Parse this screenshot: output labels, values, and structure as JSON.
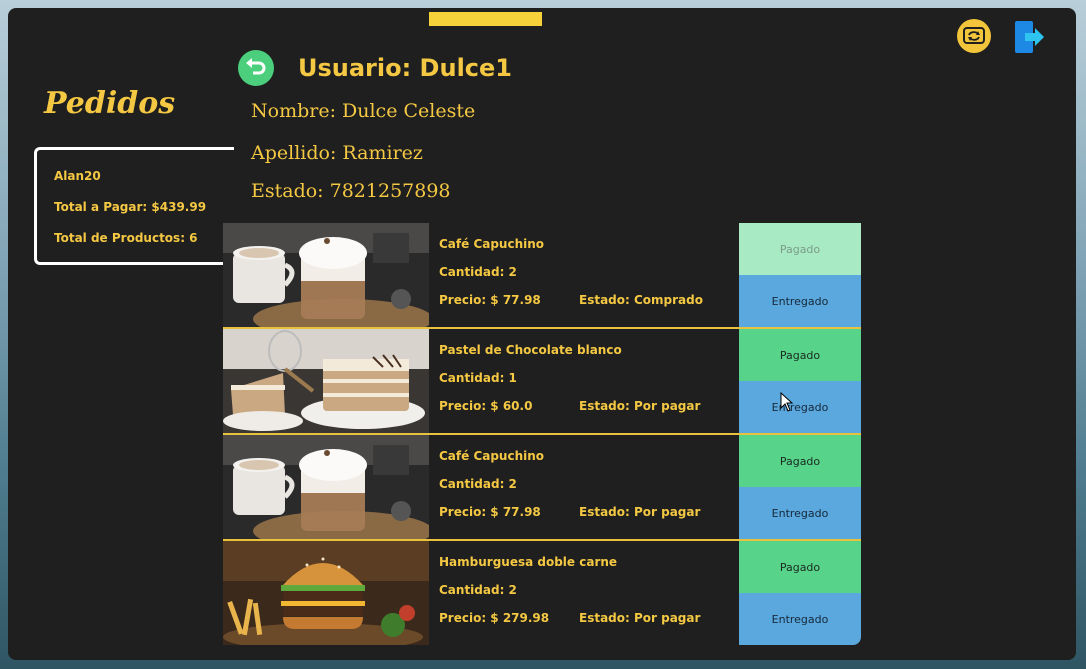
{
  "header": {
    "user_title": "Usuario: Dulce1",
    "nombre": "Nombre: Dulce Celeste",
    "apellido": "Apellido: Ramirez",
    "estado": "Estado: 7821257898"
  },
  "sidebar": {
    "title": "Pedidos",
    "order": {
      "user": "Alan20",
      "total": "Total a Pagar: $439.99",
      "count": "Total de Productos: 6"
    }
  },
  "products": [
    {
      "name": "Café Capuchino",
      "qty": "Cantidad: 2",
      "price": "Precio: $ 77.98",
      "status": "Estado: Comprado",
      "pagado": "Pagado",
      "entregado": "Entregado",
      "image": "cappuccino"
    },
    {
      "name": "Pastel de Chocolate blanco",
      "qty": "Cantidad: 1",
      "price": "Precio: $ 60.0",
      "status": "Estado: Por pagar",
      "pagado": "Pagado",
      "entregado": "Entregado",
      "image": "cake"
    },
    {
      "name": "Café Capuchino",
      "qty": "Cantidad: 2",
      "price": "Precio: $ 77.98",
      "status": "Estado: Por pagar",
      "pagado": "Pagado",
      "entregado": "Entregado",
      "image": "cappuccino"
    },
    {
      "name": "Hamburguesa doble carne",
      "qty": "Cantidad: 2",
      "price": "Precio: $ 279.98",
      "status": "Estado: Por pagar",
      "pagado": "Pagado",
      "entregado": "Entregado",
      "image": "burger"
    }
  ],
  "icons": {
    "back": "back-arrow-icon",
    "refresh": "refresh-icon",
    "logout": "logout-icon"
  },
  "colors": {
    "accent": "#f4c842",
    "background": "#1f1f20",
    "pagado": "#57d489",
    "pagado_disabled": "#a7eac4",
    "entregado": "#5aa8dd"
  }
}
